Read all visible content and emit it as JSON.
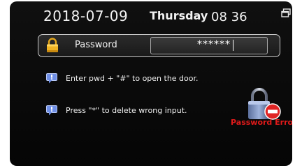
{
  "status": {
    "date": "2018-07-09",
    "weekday": "Thursday",
    "time": "08 36",
    "window_icon": "window-switch-icon"
  },
  "password": {
    "label": "Password",
    "masked_value": "******",
    "icon": "padlock-icon"
  },
  "hints": [
    {
      "icon": "speech-bubble-icon",
      "text": "Enter pwd + \"#\" to open the door."
    },
    {
      "icon": "speech-bubble-icon",
      "text": "Press \"*\" to delete wrong input."
    }
  ],
  "error": {
    "icon": "lock-error-icon",
    "message": "Password Error"
  },
  "colors": {
    "background": "#0b0b0b",
    "text": "#f2f2f2",
    "error": "#e01a1a",
    "lock_gold": "#f0b323",
    "hint_icon_blue": "#6f8fe6"
  }
}
